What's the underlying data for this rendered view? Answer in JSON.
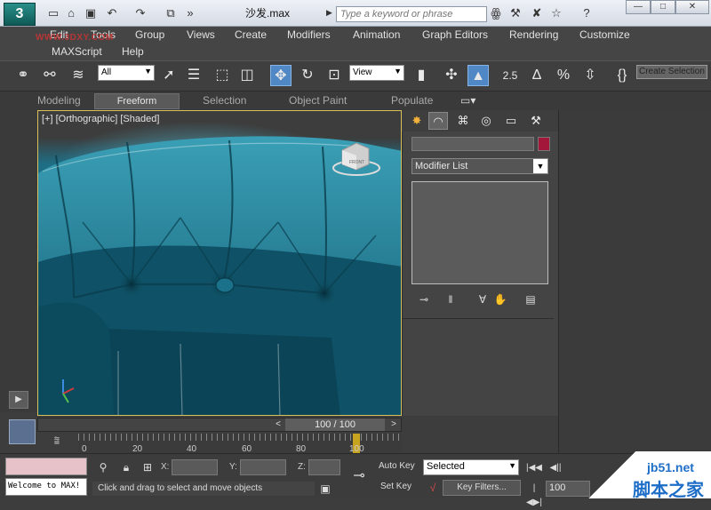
{
  "titlebar": {
    "title": "沙发.max",
    "search_placeholder": "Type a keyword or phrase",
    "logo_glyph": "3",
    "quick_access_icons": [
      "new-icon",
      "open-icon",
      "save-icon",
      "undo-icon",
      "redo-icon",
      "project-folder-icon",
      "more-icon"
    ],
    "window_buttons": [
      "—",
      "□",
      "✕"
    ]
  },
  "watermark_top": "WWW.3DXY.COM",
  "menu": {
    "row1": [
      "Edit",
      "Tools",
      "Group",
      "Views",
      "Create",
      "Modifiers",
      "Animation",
      "Graph Editors",
      "Rendering",
      "Customize"
    ],
    "row2": [
      "MAXScript",
      "Help"
    ]
  },
  "toolbar": {
    "filter_value": "All",
    "refcoord_value": "View",
    "create_selection": "Create Selection",
    "snap_label": "2.5"
  },
  "ribbon": {
    "tabs": [
      "Modeling",
      "Freeform",
      "Selection",
      "Object Paint",
      "Populate"
    ],
    "active": "Freeform"
  },
  "viewport": {
    "label": "[+] [Orthographic] [Shaded]",
    "viewcube_label": "FRONT",
    "accent": "#1b6d84"
  },
  "panel": {
    "modifier_list": "Modifier List",
    "color_swatch": "#a3173a"
  },
  "timeslider": {
    "label": "100 / 100",
    "ticks": [
      "0",
      "20",
      "40",
      "60",
      "80",
      "100"
    ]
  },
  "status": {
    "maxscript_output": "Welcome to MAX!",
    "prompt": "Click and drag to select and move objects",
    "x_label": "X:",
    "y_label": "Y:",
    "z_label": "Z:",
    "auto_key": "Auto Key",
    "set_key": "Set Key",
    "selected": "Selected",
    "key_filters": "Key Filters...",
    "frame": "100"
  },
  "jb51": {
    "url": "jb51.net",
    "name": "脚本之家"
  }
}
